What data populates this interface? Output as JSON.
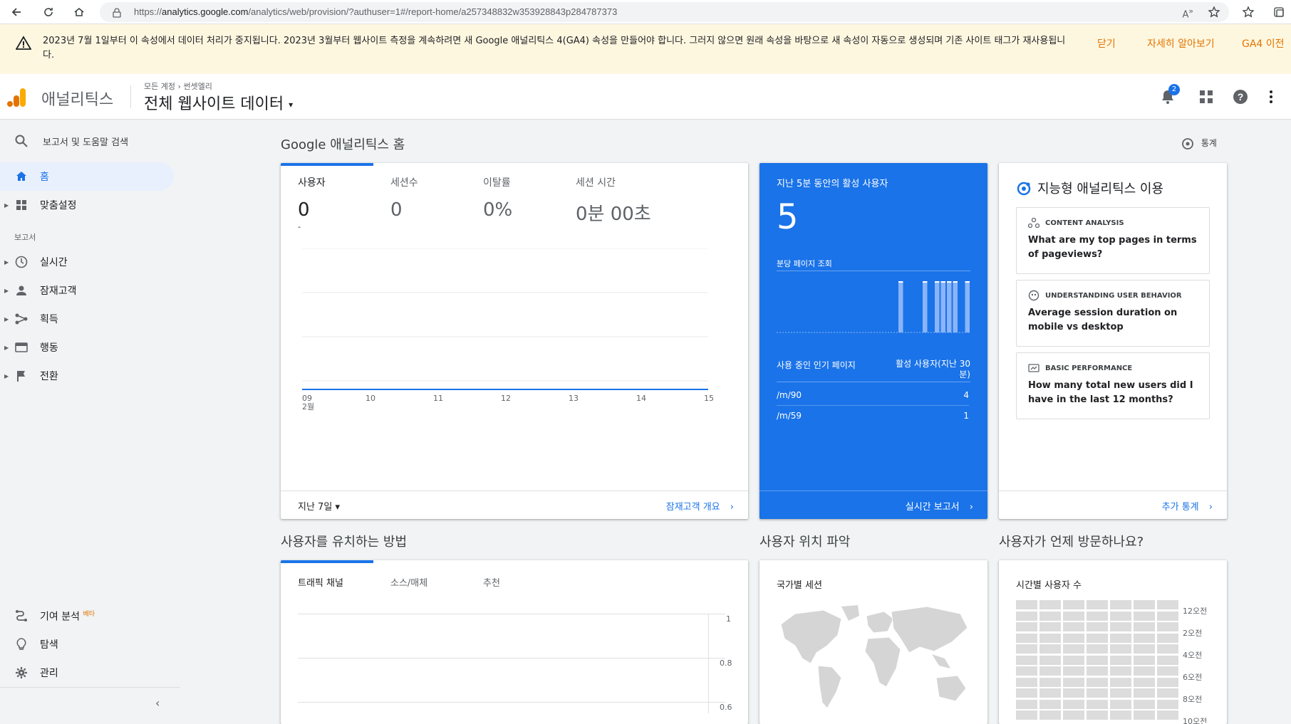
{
  "browser": {
    "url_prefix": "https://",
    "url_host": "analytics.google.com",
    "url_rest": "/analytics/web/provision/?authuser=1#/report-home/a257348832w353928843p284787373"
  },
  "banner": {
    "message": "2023년 7월 1일부터 이 속성에서 데이터 처리가 중지됩니다. 2023년 3월부터 웹사이트 측정을 계속하려면 새 Google 애널리틱스 4(GA4) 속성을 만들어야 합니다. 그러지 않으면 원래 속성을 바탕으로 새 속성이 자동으로 생성되며 기존 사이트 태그가 재사용됩니다.",
    "close": "닫기",
    "learn_more": "자세히 알아보기",
    "ga4": "GA4 이전"
  },
  "app": {
    "name": "애널리틱스",
    "crumb_all": "모든 계정",
    "crumb_account": "썬셋엘리",
    "view": "전체 웹사이트 데이터",
    "notif_count": "2"
  },
  "sidebar": {
    "search": "보고서 및 도움말 검색",
    "home": "홈",
    "custom": "맞춤설정",
    "reports_label": "보고서",
    "realtime": "실시간",
    "audience": "잠재고객",
    "acquisition": "획득",
    "behavior": "행동",
    "conversions": "전환",
    "attribution": "기여 분석",
    "beta": "베타",
    "discover": "탐색",
    "admin": "관리"
  },
  "home": {
    "title": "Google 애널리틱스 홈",
    "stats_link": "통계",
    "metrics": [
      {
        "label": "사용자",
        "value": "0",
        "sub": "-"
      },
      {
        "label": "세션수",
        "value": "0"
      },
      {
        "label": "이탈률",
        "value": "0%"
      },
      {
        "label": "세션 시간",
        "value": "0분 00초"
      }
    ],
    "range": "지난 7일",
    "audience_link": "잠재고객 개요"
  },
  "chart_data": {
    "type": "line",
    "x": [
      "09",
      "10",
      "11",
      "12",
      "13",
      "14",
      "15"
    ],
    "x_sublabel": "2월",
    "series": [
      {
        "values": [
          0,
          0,
          0,
          0,
          0,
          0,
          0
        ]
      }
    ]
  },
  "realtime": {
    "title": "지난 5분 동안의 활성 사용자",
    "count": "5",
    "pageviews_label": "분당 페이지 조회",
    "bars": [
      0,
      0,
      0,
      0,
      0,
      0,
      0,
      0,
      0,
      0,
      0,
      0,
      0,
      0,
      0,
      0,
      0,
      0,
      0,
      0,
      1,
      0,
      0,
      0,
      1,
      0,
      1,
      1,
      1,
      1,
      0,
      1
    ],
    "col_pages": "사용 중인 인기 페이지",
    "col_users": "활성 사용자(지난 30분)",
    "rows": [
      {
        "page": "/m/90",
        "users": "4"
      },
      {
        "page": "/m/59",
        "users": "1"
      }
    ],
    "link": "실시간 보고서"
  },
  "insights": {
    "title": "지능형 애널리틱스 이용",
    "cards": [
      {
        "category": "CONTENT ANALYSIS",
        "question": "What are my top pages in terms of pageviews?"
      },
      {
        "category": "UNDERSTANDING USER BEHAVIOR",
        "question": "Average session duration on mobile vs desktop"
      },
      {
        "category": "BASIC PERFORMANCE",
        "question": "How many total new users did I have in the last 12 months?"
      }
    ],
    "link": "추가 통계"
  },
  "acquire": {
    "title": "사용자를 유치하는 방법",
    "tabs": [
      "트래픽 채널",
      "소스/매체",
      "추천"
    ],
    "y_ticks": [
      "1",
      "0.8",
      "0.6"
    ]
  },
  "location": {
    "title": "사용자 위치 파악",
    "card_title": "국가별 세션"
  },
  "when": {
    "title": "사용자가 언제 방문하나요?",
    "card_title": "시간별 사용자 수",
    "hours": [
      "12오전",
      "2오전",
      "4오전",
      "6오전",
      "8오전",
      "10오전"
    ]
  }
}
